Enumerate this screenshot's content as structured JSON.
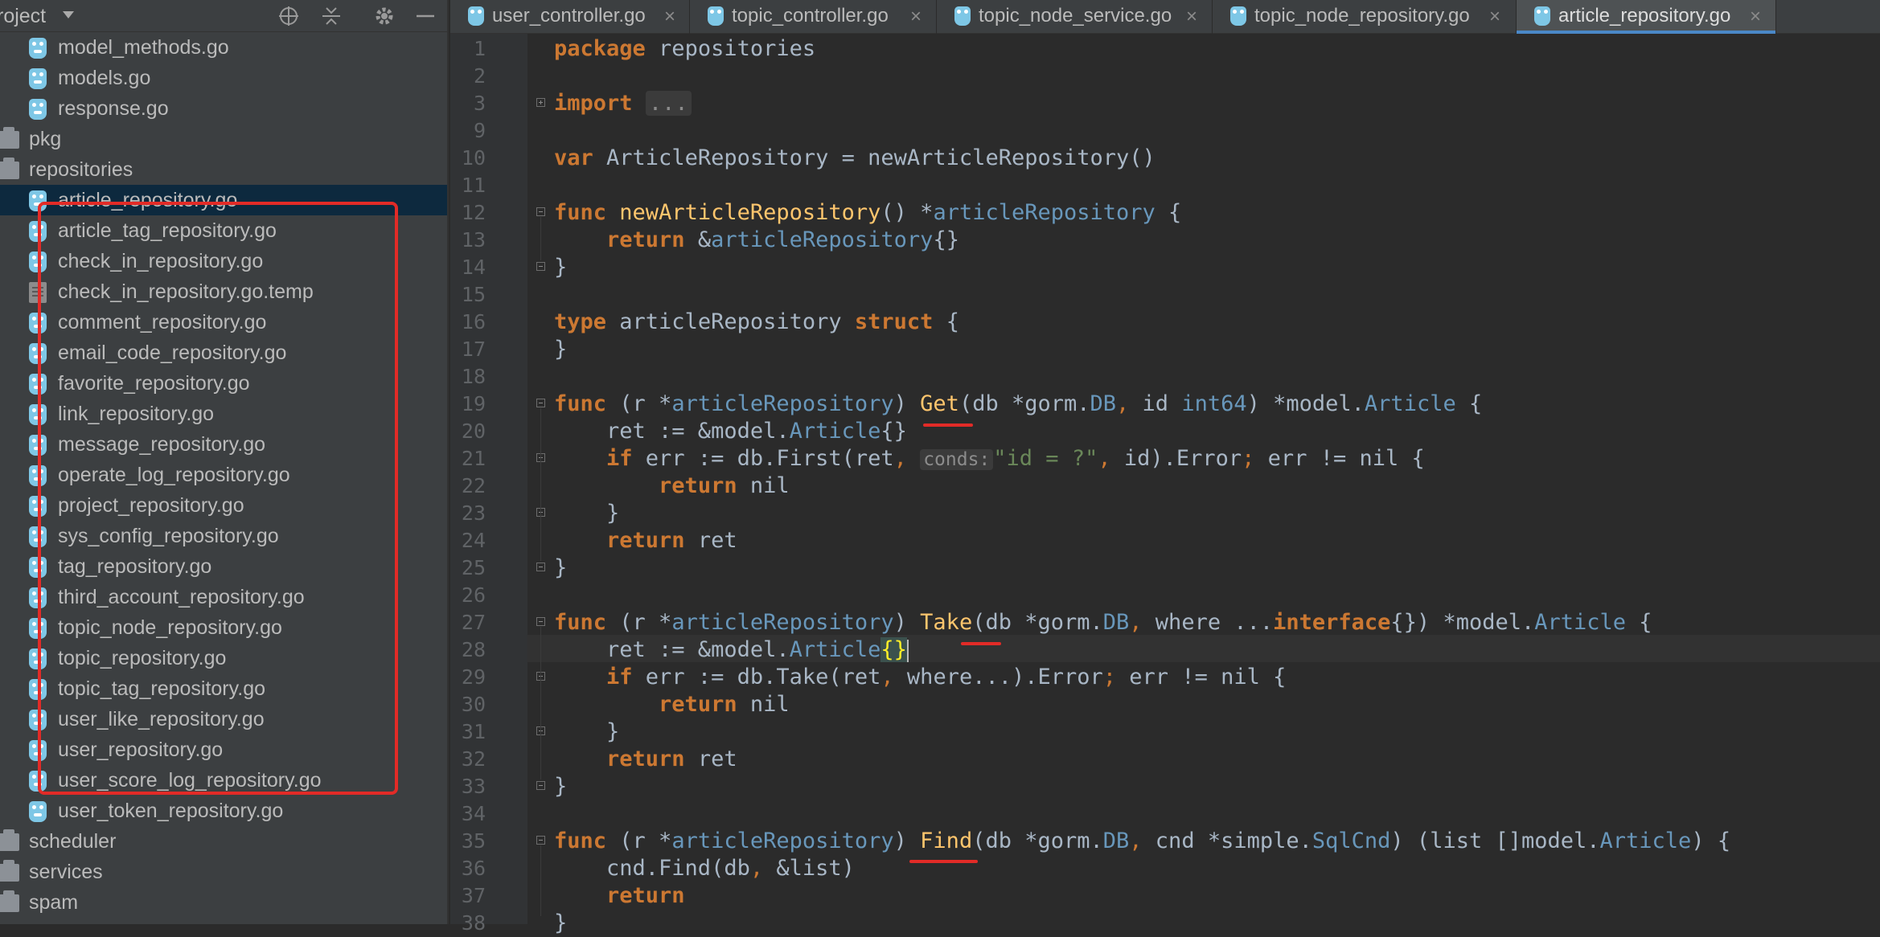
{
  "sidebar": {
    "title": "roject",
    "files_top": [
      {
        "name": "model_methods.go",
        "kind": "go"
      },
      {
        "name": "models.go",
        "kind": "go"
      },
      {
        "name": "response.go",
        "kind": "go"
      }
    ],
    "folders_mid": [
      "pkg",
      "repositories"
    ],
    "repo_files": [
      {
        "name": "article_repository.go",
        "kind": "go"
      },
      {
        "name": "article_tag_repository.go",
        "kind": "go"
      },
      {
        "name": "check_in_repository.go",
        "kind": "go"
      },
      {
        "name": "check_in_repository.go.temp",
        "kind": "temp"
      },
      {
        "name": "comment_repository.go",
        "kind": "go"
      },
      {
        "name": "email_code_repository.go",
        "kind": "go"
      },
      {
        "name": "favorite_repository.go",
        "kind": "go"
      },
      {
        "name": "link_repository.go",
        "kind": "go"
      },
      {
        "name": "message_repository.go",
        "kind": "go"
      },
      {
        "name": "operate_log_repository.go",
        "kind": "go"
      },
      {
        "name": "project_repository.go",
        "kind": "go"
      },
      {
        "name": "sys_config_repository.go",
        "kind": "go"
      },
      {
        "name": "tag_repository.go",
        "kind": "go"
      },
      {
        "name": "third_account_repository.go",
        "kind": "go"
      },
      {
        "name": "topic_node_repository.go",
        "kind": "go"
      },
      {
        "name": "topic_repository.go",
        "kind": "go"
      },
      {
        "name": "topic_tag_repository.go",
        "kind": "go"
      },
      {
        "name": "user_like_repository.go",
        "kind": "go"
      },
      {
        "name": "user_repository.go",
        "kind": "go"
      },
      {
        "name": "user_score_log_repository.go",
        "kind": "go"
      },
      {
        "name": "user_token_repository.go",
        "kind": "go"
      }
    ],
    "folders_bottom": [
      "scheduler",
      "services",
      "spam"
    ]
  },
  "tabs": [
    {
      "label": "user_controller.go",
      "active": false
    },
    {
      "label": "topic_controller.go",
      "active": false
    },
    {
      "label": "topic_node_service.go",
      "active": false
    },
    {
      "label": "topic_node_repository.go",
      "active": false
    },
    {
      "label": "article_repository.go",
      "active": true
    }
  ],
  "tab_close_glyph": "×",
  "code": {
    "line_numbers": [
      "1",
      "2",
      "3",
      "9",
      "10",
      "11",
      "12",
      "13",
      "14",
      "15",
      "16",
      "17",
      "18",
      "19",
      "20",
      "21",
      "22",
      "23",
      "24",
      "25",
      "26",
      "27",
      "28",
      "29",
      "30",
      "31",
      "32",
      "33",
      "34",
      "35",
      "36",
      "37",
      "38"
    ],
    "hint_conds": "conds:",
    "import_fold": "...",
    "tokens": {
      "package": "package",
      "repositories": "repositories",
      "import": "import",
      "var": "var",
      "func": "func",
      "return": "return",
      "type": "type",
      "struct": "struct",
      "if": "if",
      "interface": "interface",
      "ArticleRepository": "ArticleRepository",
      "newArticleRepository": "newArticleRepository",
      "articleRepository": "articleRepository",
      "Get": "Get",
      "Take": "Take",
      "Find": "Find",
      "gorm": "gorm",
      "DB": "DB",
      "int64": "int64",
      "model": "model",
      "Article": "Article",
      "simple": "simple",
      "SqlCnd": "SqlCnd",
      "id_str": "\"id = ?\""
    }
  }
}
